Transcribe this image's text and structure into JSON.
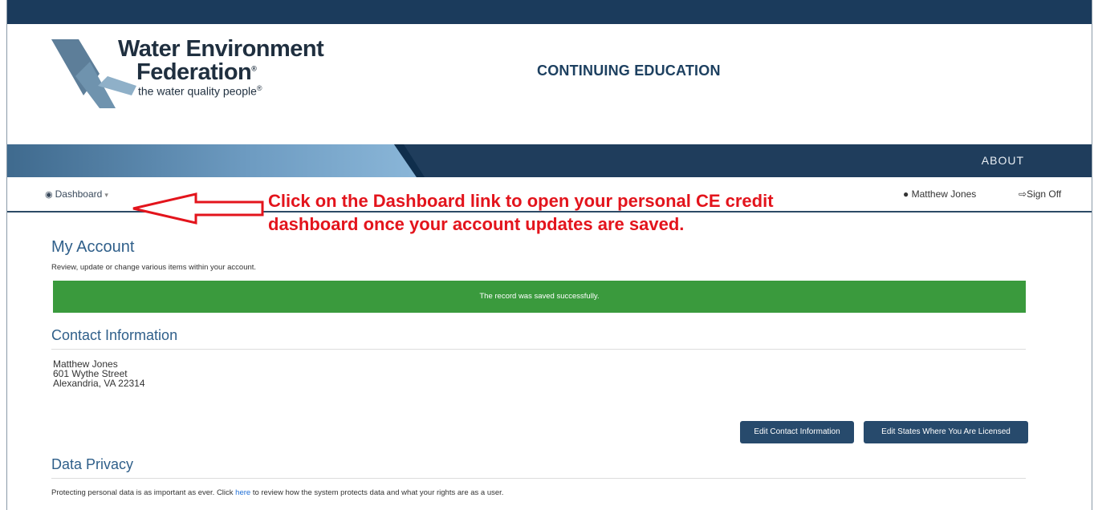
{
  "logo": {
    "line1": "Water Environment",
    "line2": "Federation",
    "line3": "the water quality people",
    "mark": "®"
  },
  "header": {
    "title": "CONTINUING EDUCATION"
  },
  "nav": {
    "about": "ABOUT"
  },
  "subnav": {
    "dashboard": "Dashboard",
    "dashboard_icon": "dashboard-icon",
    "user_name": "Matthew Jones",
    "user_icon": "user-icon",
    "sign_off": "Sign Off",
    "sign_off_icon": "sign-out-icon"
  },
  "annotation": {
    "line1": "Click on the Dashboard link to open your personal CE credit",
    "line2": "dashboard once your account updates are saved."
  },
  "account": {
    "title": "My Account",
    "subtitle": "Review, update or change various items within your account.",
    "alert": "The record was saved successfully."
  },
  "contact": {
    "heading": "Contact Information",
    "name": "Matthew Jones",
    "street": "601 Wythe Street",
    "city": "Alexandria, VA 22314",
    "edit_contact_button": "Edit Contact Information",
    "edit_states_button": "Edit States Where You Are Licensed"
  },
  "privacy": {
    "heading": "Data Privacy",
    "text_before": "Protecting personal data is as important as ever. Click ",
    "link": "here",
    "text_after": " to review how the system protects data and what your rights are as a user."
  },
  "colors": {
    "navy": "#1f3d5c",
    "heading_blue": "#2f5f8a",
    "alert_green": "#3a9a3d",
    "annotation_red": "#e3141c",
    "button": "#274a6c"
  }
}
